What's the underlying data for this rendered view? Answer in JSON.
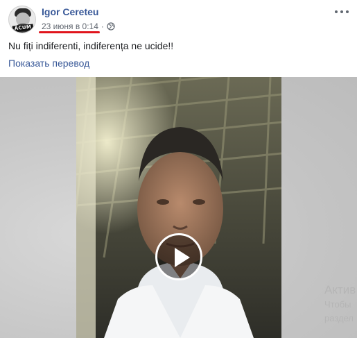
{
  "post": {
    "author": "Igor Cereteu",
    "avatar_badge": "ACUM",
    "timestamp": "23 июня в 0:14",
    "separator": "·",
    "privacy_icon": "globe-icon",
    "text": "Nu fiți indiferenti, indiferența ne ucide!!",
    "translate_link": "Показать перевод",
    "more_icon": "more-options-icon"
  },
  "video": {
    "play_icon": "play-icon"
  },
  "overlay": {
    "line1": "Актив",
    "line2": "Чтобы",
    "line3": "раздел"
  },
  "colors": {
    "link": "#385898",
    "meta": "#616770",
    "text": "#1c1e21",
    "underline": "#e0141c"
  }
}
